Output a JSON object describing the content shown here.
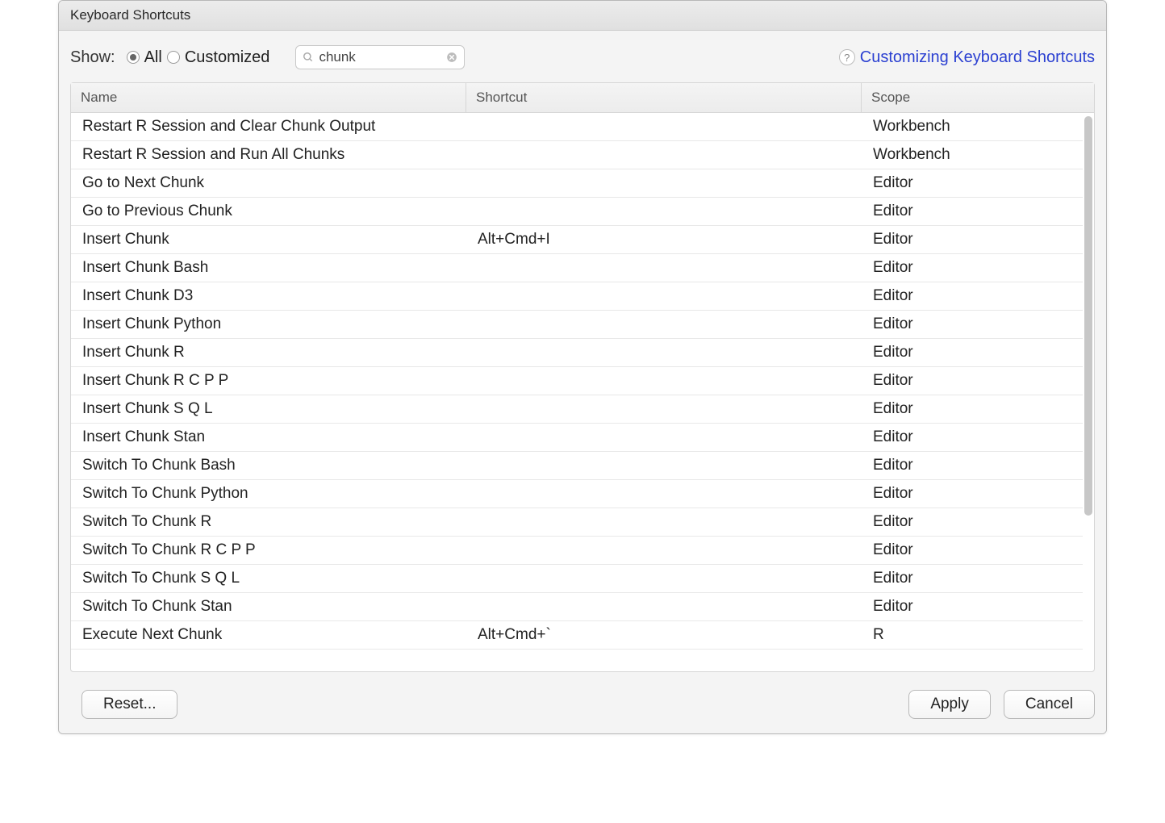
{
  "dialog_title": "Keyboard Shortcuts",
  "show": {
    "label": "Show:",
    "all_label": "All",
    "customized_label": "Customized",
    "selected": "all"
  },
  "search": {
    "value": "chunk"
  },
  "help_link": "Customizing Keyboard Shortcuts",
  "columns": {
    "name": "Name",
    "shortcut": "Shortcut",
    "scope": "Scope"
  },
  "rows": [
    {
      "name": "Restart R Session and Clear Chunk Output",
      "shortcut": "",
      "scope": "Workbench"
    },
    {
      "name": "Restart R Session and Run All Chunks",
      "shortcut": "",
      "scope": "Workbench"
    },
    {
      "name": "Go to Next Chunk",
      "shortcut": "",
      "scope": "Editor"
    },
    {
      "name": "Go to Previous Chunk",
      "shortcut": "",
      "scope": "Editor"
    },
    {
      "name": "Insert Chunk",
      "shortcut": "Alt+Cmd+I",
      "scope": "Editor"
    },
    {
      "name": "Insert Chunk Bash",
      "shortcut": "",
      "scope": "Editor"
    },
    {
      "name": "Insert Chunk D3",
      "shortcut": "",
      "scope": "Editor"
    },
    {
      "name": "Insert Chunk Python",
      "shortcut": "",
      "scope": "Editor"
    },
    {
      "name": "Insert Chunk R",
      "shortcut": "",
      "scope": "Editor"
    },
    {
      "name": "Insert Chunk R C P P",
      "shortcut": "",
      "scope": "Editor"
    },
    {
      "name": "Insert Chunk S Q L",
      "shortcut": "",
      "scope": "Editor"
    },
    {
      "name": "Insert Chunk Stan",
      "shortcut": "",
      "scope": "Editor"
    },
    {
      "name": "Switch To Chunk Bash",
      "shortcut": "",
      "scope": "Editor"
    },
    {
      "name": "Switch To Chunk Python",
      "shortcut": "",
      "scope": "Editor"
    },
    {
      "name": "Switch To Chunk R",
      "shortcut": "",
      "scope": "Editor"
    },
    {
      "name": "Switch To Chunk R C P P",
      "shortcut": "",
      "scope": "Editor"
    },
    {
      "name": "Switch To Chunk S Q L",
      "shortcut": "",
      "scope": "Editor"
    },
    {
      "name": "Switch To Chunk Stan",
      "shortcut": "",
      "scope": "Editor"
    },
    {
      "name": "Execute Next Chunk",
      "shortcut": "Alt+Cmd+`",
      "scope": "R"
    }
  ],
  "buttons": {
    "reset": "Reset...",
    "apply": "Apply",
    "cancel": "Cancel"
  }
}
